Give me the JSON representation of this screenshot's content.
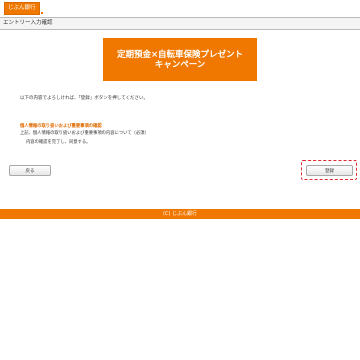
{
  "header": {
    "logo_text": "じぶん銀行",
    "page_title": "エントリー入力確認"
  },
  "banner": {
    "line1": "定期預金×自転車保険プレゼント",
    "line2": "キャンペーン"
  },
  "main": {
    "intro_text": "以下の内容でよろしければ、「登録」ボタンを押してください。",
    "notice_heading": "個人情報の取り扱いおよび重要事項の確認",
    "notice_text": "上記、個人情報の取り扱いおよび重要事項の内容について（必須）",
    "confirm_text": "内容の確認を完了し、同意する。"
  },
  "buttons": {
    "back_label": "戻る",
    "register_label": "登録"
  },
  "footer": {
    "copyright": "(C) じぶん銀行"
  },
  "colors": {
    "brand": "#f07800",
    "highlight": "#e0282f"
  }
}
